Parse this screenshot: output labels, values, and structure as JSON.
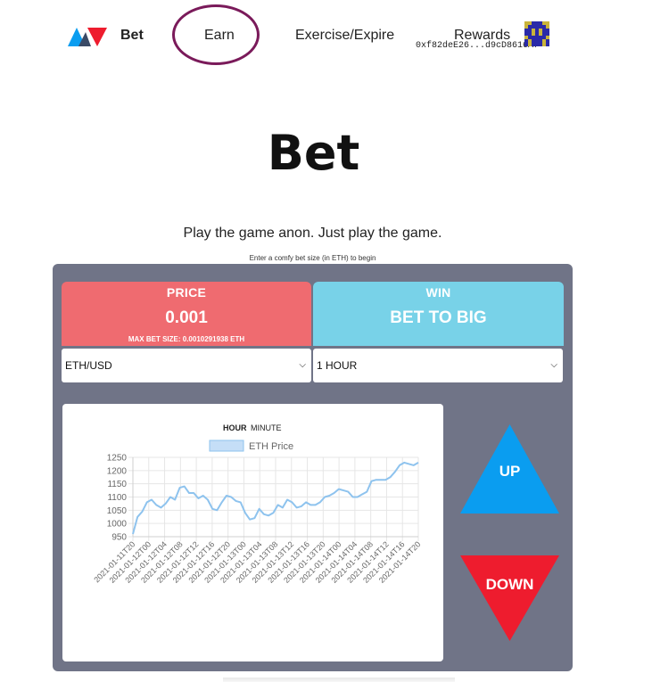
{
  "nav": {
    "items": [
      {
        "label": "Bet"
      },
      {
        "label": "Earn"
      },
      {
        "label": "Exercise/Expire"
      },
      {
        "label": "Rewards"
      }
    ],
    "wallet_address": "0xf82deE26...d9cD8616Af"
  },
  "hero": {
    "title": "Bet",
    "tagline": "Play the game anon. Just play the game.",
    "hint": "Enter a comfy bet size (in ETH) to begin"
  },
  "price_box": {
    "heading": "PRICE",
    "value": "0.001",
    "max_bet": "MAX BET SIZE: 0.0010291938 ETH"
  },
  "win_box": {
    "heading": "WIN",
    "value": "BET TO BIG"
  },
  "selects": {
    "pair": "ETH/USD",
    "duration": "1 HOUR"
  },
  "chart_toggle": {
    "hour": "HOUR",
    "minute": "MINUTE"
  },
  "buttons": {
    "up": "UP",
    "down": "DOWN"
  },
  "colors": {
    "price_bg": "#ef6b70",
    "win_bg": "#78d2e8",
    "panel_bg": "#707487",
    "up": "#0a9df0",
    "down": "#ee1c2e",
    "line": "#8ec3ee"
  },
  "chart_data": {
    "type": "line",
    "title": "",
    "xlabel": "",
    "ylabel": "",
    "ylim": [
      950,
      1250
    ],
    "yticks": [
      950,
      1000,
      1050,
      1100,
      1150,
      1200,
      1250
    ],
    "legend": "top",
    "grid": true,
    "xtick_labels": [
      "2021-01-11T20",
      "2021-01-12T00",
      "2021-01-12T04",
      "2021-01-12T08",
      "2021-01-12T12",
      "2021-01-12T16",
      "2021-01-12T20",
      "2021-01-13T00",
      "2021-01-13T04",
      "2021-01-13T08",
      "2021-01-13T12",
      "2021-01-13T16",
      "2021-01-13T20",
      "2021-01-14T00",
      "2021-01-14T04",
      "2021-01-14T08",
      "2021-01-14T12",
      "2021-01-14T16",
      "2021-01-14T20"
    ],
    "series": [
      {
        "name": "ETH Price",
        "values": [
          960,
          1025,
          1045,
          1080,
          1090,
          1070,
          1060,
          1075,
          1100,
          1090,
          1135,
          1140,
          1115,
          1115,
          1095,
          1105,
          1090,
          1055,
          1050,
          1080,
          1105,
          1100,
          1085,
          1080,
          1040,
          1015,
          1020,
          1055,
          1035,
          1030,
          1040,
          1070,
          1060,
          1090,
          1080,
          1060,
          1065,
          1080,
          1070,
          1070,
          1080,
          1100,
          1105,
          1115,
          1130,
          1125,
          1120,
          1100,
          1100,
          1110,
          1120,
          1160,
          1165,
          1165,
          1165,
          1175,
          1195,
          1220,
          1230,
          1225,
          1220,
          1230
        ]
      }
    ]
  }
}
